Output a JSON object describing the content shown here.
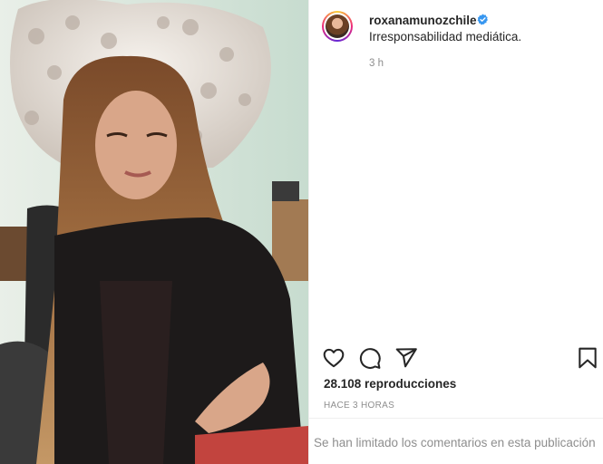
{
  "post": {
    "username": "roxanamunozchile",
    "caption": "Irresponsabilidad mediática.",
    "caption_time": "3 h",
    "views": "28.108 reproducciones",
    "time_ago": "HACE 3 HORAS",
    "comments_limited": "Se han limitado los comentarios en esta publicación"
  },
  "icons": {
    "verified": "verified-badge-icon",
    "like": "heart-icon",
    "comment": "comment-icon",
    "share": "share-icon",
    "save": "bookmark-icon"
  },
  "colors": {
    "verified": "#3897f0",
    "text": "#262626",
    "muted": "#8e8e8e"
  }
}
